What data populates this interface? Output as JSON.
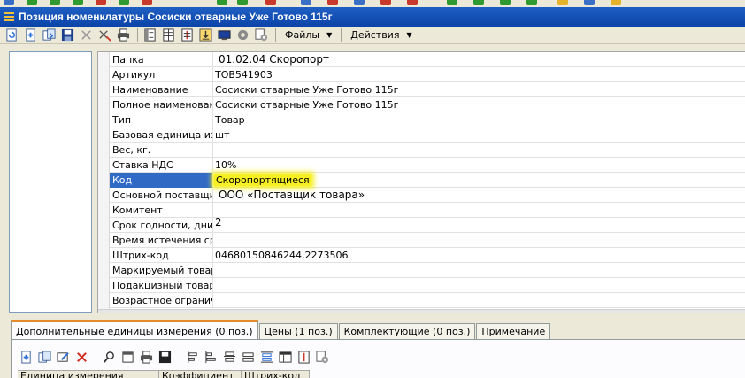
{
  "window": {
    "title": "Позиция номенклатуры Сосиски отварные Уже Готово 115г"
  },
  "toolbar": {
    "files_label": "Файлы",
    "actions_label": "Действия"
  },
  "properties": [
    {
      "key": "Папка",
      "value": "01.02.04 Скоропорт"
    },
    {
      "key": "Артикул",
      "value": "ТОВ541903"
    },
    {
      "key": "Наименование",
      "value": "Сосиски отварные Уже Готово 115г"
    },
    {
      "key": "Полное наименование",
      "value": "Сосиски отварные Уже Готово 115г"
    },
    {
      "key": "Тип",
      "value": "Товар"
    },
    {
      "key": "Базовая единица изме",
      "value": "шт"
    },
    {
      "key": "Вес, кг.",
      "value": ""
    },
    {
      "key": "Ставка НДС",
      "value": "10%"
    },
    {
      "key": "Код",
      "value": "Скоропортящиеся"
    },
    {
      "key": "Основной поставщик",
      "value": "ООО «Поставщик товара»"
    },
    {
      "key": "Комитент",
      "value": ""
    },
    {
      "key": "Срок годности, дни",
      "value": "2"
    },
    {
      "key": "Время истечения срок",
      "value": ""
    },
    {
      "key": "Штрих-код",
      "value": "04680150846244,2273506"
    },
    {
      "key": "Маркируемый товар",
      "value": ""
    },
    {
      "key": "Подакцизный товар",
      "value": ""
    },
    {
      "key": "Возрастное огранич",
      "value": ""
    }
  ],
  "tabs": [
    {
      "label": "Дополнительные единицы измерения (0 поз.)"
    },
    {
      "label": "Цены (1 поз.)"
    },
    {
      "label": "Комплектующие (0 поз.)"
    },
    {
      "label": "Примечание"
    }
  ],
  "subtable": {
    "columns": [
      "Единица измерения",
      "Коэффициент",
      "Штрих-код"
    ]
  },
  "colors": {
    "title_bar": "#0b44a8",
    "selection": "#316ac5",
    "highlight": "#f6ef24",
    "active_tab_accent": "#e68b2c"
  }
}
